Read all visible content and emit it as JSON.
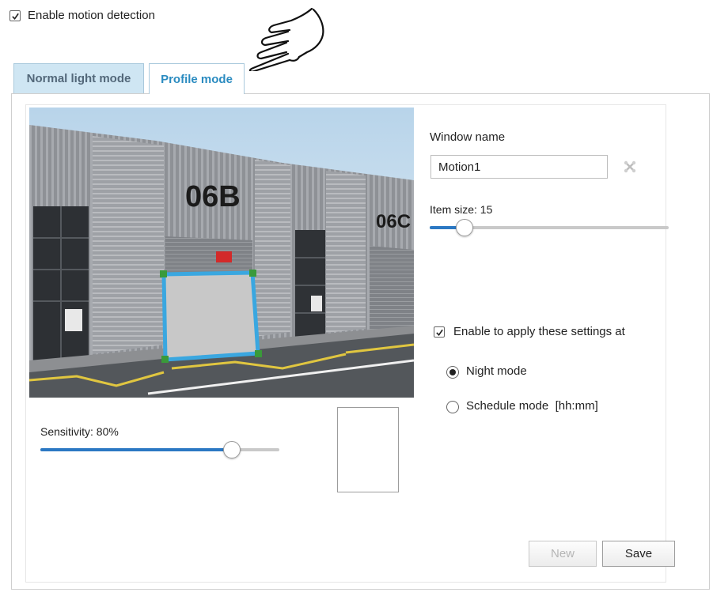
{
  "motion": {
    "enable_label": "Enable motion detection",
    "enabled": true
  },
  "tabs": [
    {
      "label": "Normal light mode",
      "active": false
    },
    {
      "label": "Profile mode",
      "active": true
    }
  ],
  "preview": {
    "building_labels": [
      "06B",
      "06C"
    ]
  },
  "window": {
    "name_label": "Window name",
    "name_value": "Motion1",
    "item_size_label": "Item size: 15",
    "item_size_value": 15
  },
  "sensitivity": {
    "label": "Sensitivity: 80%",
    "value": 80
  },
  "apply": {
    "label": "Enable to apply these settings at",
    "checked": true,
    "options": [
      {
        "label": "Night mode",
        "selected": true
      },
      {
        "label": "Schedule mode  [hh:mm]",
        "selected": false
      }
    ]
  },
  "buttons": {
    "new_label": "New",
    "save_label": "Save"
  },
  "colors": {
    "accent": "#2b78c3",
    "tab_active_text": "#2a8bc0",
    "tab_inactive_bg": "#cfe6f3",
    "selection_box": "#3aa7e0"
  },
  "icons": {
    "pointer": "pointing-hand-icon",
    "delete": "delete-window-icon"
  }
}
